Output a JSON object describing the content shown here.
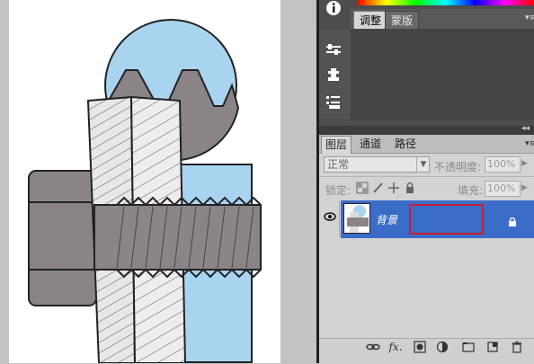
{
  "top_panel": {
    "tabs": [
      {
        "label": "调整"
      },
      {
        "label": "蒙版"
      }
    ],
    "menu_glyph": "▾≡"
  },
  "collapse_glyph": "◂◂",
  "layers_panel": {
    "tabs": [
      {
        "label": "图层"
      },
      {
        "label": "通道"
      },
      {
        "label": "路径"
      }
    ],
    "menu_glyph": "▾≡",
    "blend_mode": "正常",
    "opacity_label": "不透明度:",
    "opacity_value": "100%",
    "lock_label": "锁定:",
    "fill_label": "填充:",
    "fill_value": "100%",
    "layer": {
      "name": "背景"
    }
  },
  "colors": {
    "selection_blue": "#3b6cc8",
    "highlight_red": "#c9202f",
    "bolt_gray": "#8a8486",
    "light_blue": "#a9d4ef"
  },
  "icons": {
    "info": "info-icon",
    "tool_1": "brush-settings-icon",
    "tool_2": "clone-source-icon",
    "tool_3": "tool-presets-icon",
    "bottom": [
      "link-layers-icon",
      "fx-icon",
      "add-mask-icon",
      "adjustment-layer-icon",
      "new-group-icon",
      "new-layer-icon",
      "trash-icon"
    ]
  }
}
